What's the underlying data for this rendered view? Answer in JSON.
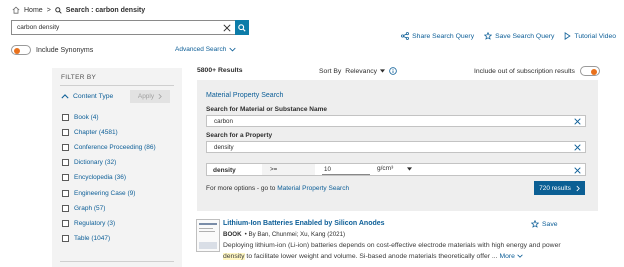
{
  "breadcrumb": {
    "home": "Home",
    "separator": ">",
    "current": "Search : carbon density"
  },
  "search": {
    "value": "carbon density",
    "placeholder": ""
  },
  "synonyms": {
    "label": "Include Synonyms"
  },
  "advanced_search": "Advanced Search",
  "top_actions": {
    "share": "Share Search Query",
    "save": "Save Search Query",
    "tutorial": "Tutorial Video"
  },
  "filter": {
    "title": "FILTER BY",
    "content_type_label": "Content Type",
    "apply_label": "Apply",
    "items": [
      {
        "label": "Book (4)"
      },
      {
        "label": "Chapter (4581)"
      },
      {
        "label": "Conference Proceeding (86)"
      },
      {
        "label": "Dictionary (32)"
      },
      {
        "label": "Encyclopedia (36)"
      },
      {
        "label": "Engineering Case (9)"
      },
      {
        "label": "Graph (57)"
      },
      {
        "label": "Regulatory (3)"
      },
      {
        "label": "Table (1047)"
      }
    ]
  },
  "results": {
    "count": "5800+ Results",
    "sort_by_label": "Sort By",
    "sort_value": "Relevancy",
    "subscription_label": "Include out of subscription results"
  },
  "material_property": {
    "title": "Material Property Search",
    "substance_label": "Search for Material or Substance Name",
    "substance_value": "carbon",
    "property_label": "Search for a Property",
    "property_value": "density",
    "density_prop": "density",
    "operator": ">=",
    "value": "10",
    "unit": "g/cm³",
    "more_text": "For more options - go to",
    "more_link": "Material Property Search",
    "results_button": "720 results"
  },
  "result_item": {
    "title": "Lithium-Ion Batteries Enabled by Silicon Anodes",
    "type": "BOOK",
    "meta": "• By Ban, Chunmei; Xu, Kang (2021)",
    "snippet_before": "Deploying lithium-ion (Li-ion) batteries depends on cost-effective electrode materials with high energy and power ",
    "snippet_highlight": "density",
    "snippet_after": " to facilitate lower weight and volume. Si-based anode materials theoretically offer ... ",
    "more_label": "More",
    "save_label": "Save"
  },
  "colors": {
    "accent": "#0c5e97",
    "toggle_knob": "#e9711c",
    "search_button": "#0c7ca8",
    "results_button": "#0b5f94",
    "panel_bg": "#eeeeee"
  }
}
